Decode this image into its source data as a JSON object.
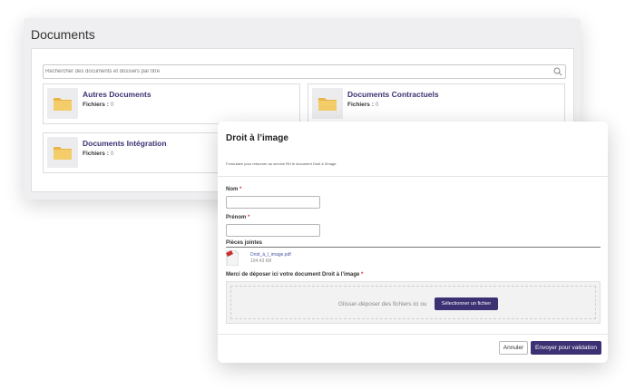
{
  "documents": {
    "title": "Documents",
    "search_placeholder": "Rechercher des documents et dossiers par titre",
    "folders": [
      {
        "name": "Autres Documents",
        "files_label": "Fichiers :",
        "count": "0"
      },
      {
        "name": "Documents Contractuels",
        "files_label": "Fichiers :",
        "count": "0"
      },
      {
        "name": "Documents Intégration",
        "files_label": "Fichiers :",
        "count": "0"
      }
    ]
  },
  "modal": {
    "title": "Droit à l’image",
    "description": "Formulaire pour retourner au service RH le document Droit à l’image.",
    "fields": {
      "nom_label": "Nom",
      "prenom_label": "Prénom",
      "required_mark": "*"
    },
    "attachments": {
      "title": "Pièces jointes",
      "file_name": "Droit_à_l_image.pdf",
      "file_size": "104.43 KB",
      "file_badge": "PDF"
    },
    "upload": {
      "label": "Merci de déposer ici votre document Droit à l’image",
      "drop_text": "Glisser-déposer des fichiers ici ou",
      "select_button": "Sélectionner un fichier"
    },
    "buttons": {
      "cancel": "Annuler",
      "submit": "Envoyer pour validation"
    }
  },
  "colors": {
    "accent": "#3c3273",
    "link": "#4a5aa5",
    "folder": "#f0c25a",
    "required": "#dd3333"
  }
}
